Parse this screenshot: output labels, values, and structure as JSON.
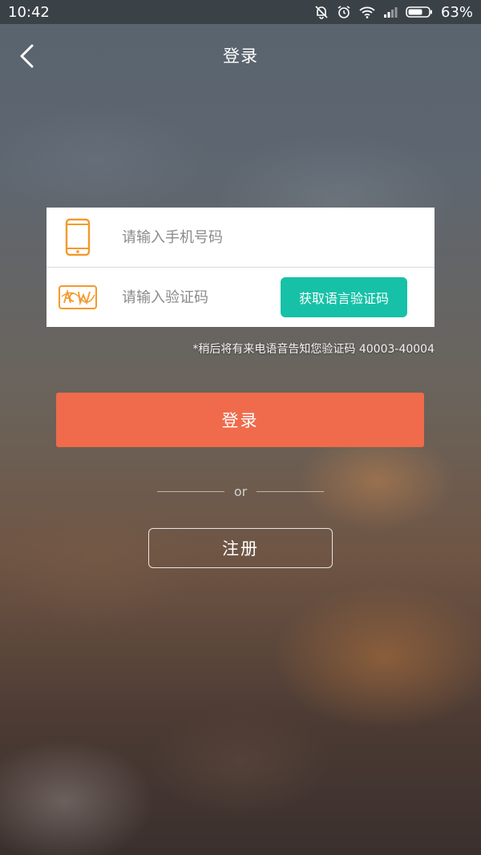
{
  "status_bar": {
    "time": "10:42",
    "battery": "63%",
    "icons": [
      "mute-icon",
      "alarm-icon",
      "wifi-icon",
      "signal-icon",
      "battery-icon"
    ]
  },
  "header": {
    "title": "登录",
    "back_icon": "back-chevron-icon"
  },
  "form": {
    "phone_placeholder": "请输入手机号码",
    "phone_icon": "phone-icon",
    "code_placeholder": "请输入验证码",
    "code_icon": "captcha-icon",
    "voice_code_button": "获取语言验证码"
  },
  "hint": "*稍后将有来电语音告知您验证码 40003-40004",
  "login_button": "登录",
  "divider_text": "or",
  "register_button": "注册",
  "colors": {
    "accent_login": "#ef6b4c",
    "accent_voice": "#17c1a7",
    "icon_orange": "#f39a2b"
  }
}
